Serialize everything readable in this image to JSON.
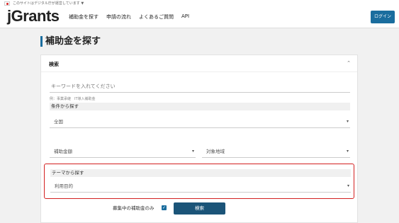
{
  "header": {
    "gov_text": "このサイトはデジタル庁が運営しています ▼",
    "logo_j": "j",
    "logo_rest": "Grants",
    "nav": [
      "補助金を探す",
      "申請の流れ",
      "よくあるご質問",
      "API"
    ],
    "login": "ログイン"
  },
  "page": {
    "title": "補助金を探す"
  },
  "search": {
    "panel_title": "検索",
    "chevron": "⌃",
    "keyword_placeholder": "キーワードを入れてください",
    "keyword_hint": "例：事業承継　IT導入補助金",
    "conditions_label": "条件から探す",
    "area": "全国",
    "amount": "補助金額",
    "target": "対象地域",
    "theme_label": "テーマから探す",
    "purpose": "利用目的",
    "caret": "▾",
    "recruiting_only": "募集中の補助金のみ",
    "check": "✓",
    "search_button": "検索"
  }
}
